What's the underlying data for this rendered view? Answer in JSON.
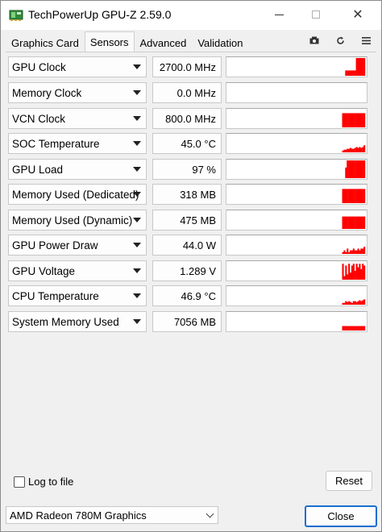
{
  "window": {
    "title": "TechPowerUp GPU-Z 2.59.0",
    "close_glyph": "✕"
  },
  "tabs": [
    {
      "label": "Graphics Card",
      "active": false
    },
    {
      "label": "Sensors",
      "active": true
    },
    {
      "label": "Advanced",
      "active": false
    },
    {
      "label": "Validation",
      "active": false
    }
  ],
  "toolbar_icons": [
    "camera-icon",
    "refresh-icon",
    "menu-icon"
  ],
  "graph_color": "#ff0000",
  "sensors": [
    {
      "name": "GPU Clock",
      "value": "2700.0 MHz",
      "graph": [
        0,
        0,
        0.3,
        0.3,
        0.3,
        0.3,
        0.3,
        0.3,
        0.3,
        1,
        1,
        1,
        1,
        1,
        1
      ]
    },
    {
      "name": "Memory Clock",
      "value": "0.0 MHz",
      "graph": []
    },
    {
      "name": "VCN Clock",
      "value": "800.0 MHz",
      "graph": [
        0.8,
        0.8,
        0.8,
        0.8,
        0.8,
        0.8,
        0.8,
        0.8,
        0.8,
        0.8,
        0.8,
        0.8,
        0.8,
        0.8,
        0.8
      ]
    },
    {
      "name": "SOC Temperature",
      "value": "45.0 °C",
      "graph": [
        0.1,
        0.15,
        0.15,
        0.2,
        0.2,
        0.25,
        0.2,
        0.2,
        0.25,
        0.3,
        0.25,
        0.3,
        0.25,
        0.3,
        0.4
      ]
    },
    {
      "name": "GPU Load",
      "value": "97 %",
      "graph": [
        0,
        0,
        0.6,
        1,
        1,
        1,
        1,
        1,
        1,
        1,
        1,
        1,
        1,
        1,
        1
      ]
    },
    {
      "name": "Memory Used (Dedicated)",
      "value": "318 MB",
      "graph": [
        0.8,
        0.8,
        0.8,
        0.8,
        0.8,
        0.8,
        0.8,
        0.8,
        0.8,
        0.8,
        0.8,
        0.8,
        0.8,
        0.8,
        0.8
      ]
    },
    {
      "name": "Memory Used (Dynamic)",
      "value": "475 MB",
      "graph": [
        0.7,
        0.7,
        0.7,
        0.7,
        0.7,
        0.7,
        0.7,
        0.7,
        0.7,
        0.7,
        0.7,
        0.7,
        0.7,
        0.7,
        0.7
      ]
    },
    {
      "name": "GPU Power Draw",
      "value": "44.0 W",
      "graph": [
        0.1,
        0.2,
        0.1,
        0.3,
        0.1,
        0.2,
        0.2,
        0.3,
        0.2,
        0.2,
        0.3,
        0.2,
        0.3,
        0.3,
        0.4
      ]
    },
    {
      "name": "GPU Voltage",
      "value": "1.289 V",
      "graph": [
        0.9,
        0.2,
        0.8,
        0.3,
        0.9,
        0.4,
        0.8,
        0.9,
        0.5,
        0.9,
        0.7,
        0.9,
        0.6,
        0.9,
        0.8
      ]
    },
    {
      "name": "CPU Temperature",
      "value": "46.9 °C",
      "graph": [
        0.1,
        0.1,
        0.2,
        0.15,
        0.2,
        0.15,
        0.1,
        0.2,
        0.2,
        0.15,
        0.2,
        0.25,
        0.2,
        0.25,
        0.3
      ]
    },
    {
      "name": "System Memory Used",
      "value": "7056 MB",
      "graph": [
        0.25,
        0.25,
        0.25,
        0.25,
        0.25,
        0.25,
        0.25,
        0.25,
        0.25,
        0.25,
        0.25,
        0.25,
        0.25,
        0.25,
        0.25
      ]
    }
  ],
  "log_to_file": {
    "label": "Log to file",
    "checked": false
  },
  "reset_label": "Reset",
  "gpu_select": {
    "value": "AMD Radeon 780M Graphics"
  },
  "close_label": "Close"
}
